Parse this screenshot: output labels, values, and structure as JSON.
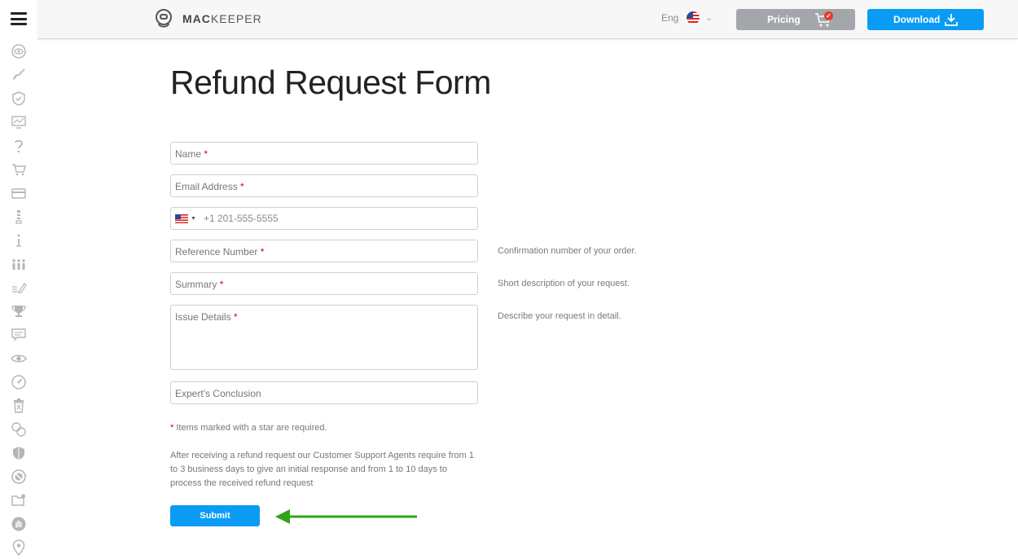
{
  "header": {
    "logo_mac": "MAC",
    "logo_keeper": "KEEPER",
    "language": "Eng",
    "pricing_label": "Pricing",
    "cart_badge": "✓",
    "download_label": "Download"
  },
  "sidebar": {
    "icons": [
      "eye-scan-icon",
      "broom-icon",
      "shield-check-icon",
      "monitor-chart-icon",
      "question-icon",
      "cart-icon",
      "credit-card-icon",
      "zipper-icon",
      "info-icon",
      "people-icon",
      "edit-list-icon",
      "trophy-icon",
      "chat-icon",
      "eye-icon",
      "gauge-icon",
      "trash-icon",
      "circles-icon",
      "shield-icon",
      "blocked-icon",
      "folder-gear-icon",
      "hand-icon",
      "location-pin-icon"
    ]
  },
  "form": {
    "title": "Refund Request Form",
    "name_placeholder": "Name",
    "email_placeholder": "Email Address",
    "phone_placeholder": "+1 201-555-5555",
    "reference_placeholder": "Reference Number",
    "summary_placeholder": "Summary",
    "issue_placeholder": "Issue Details",
    "conclusion_placeholder": "Expert's Conclusion",
    "required_mark": "*",
    "hint_reference": "Confirmation number of your order.",
    "hint_summary": "Short description of your request.",
    "hint_issue": "Describe your request in detail.",
    "required_note": "Items marked with a star are required.",
    "info_text": "After receiving a refund request our Customer Support Agents require from 1 to 3 business days to give an initial response and from 1 to 10 days to process the received refund request",
    "submit_label": "Submit"
  },
  "colors": {
    "accent": "#0a9cf4",
    "pricing_bg": "#a3a6aa",
    "required": "#d0021b",
    "arrow": "#2ea51a"
  }
}
